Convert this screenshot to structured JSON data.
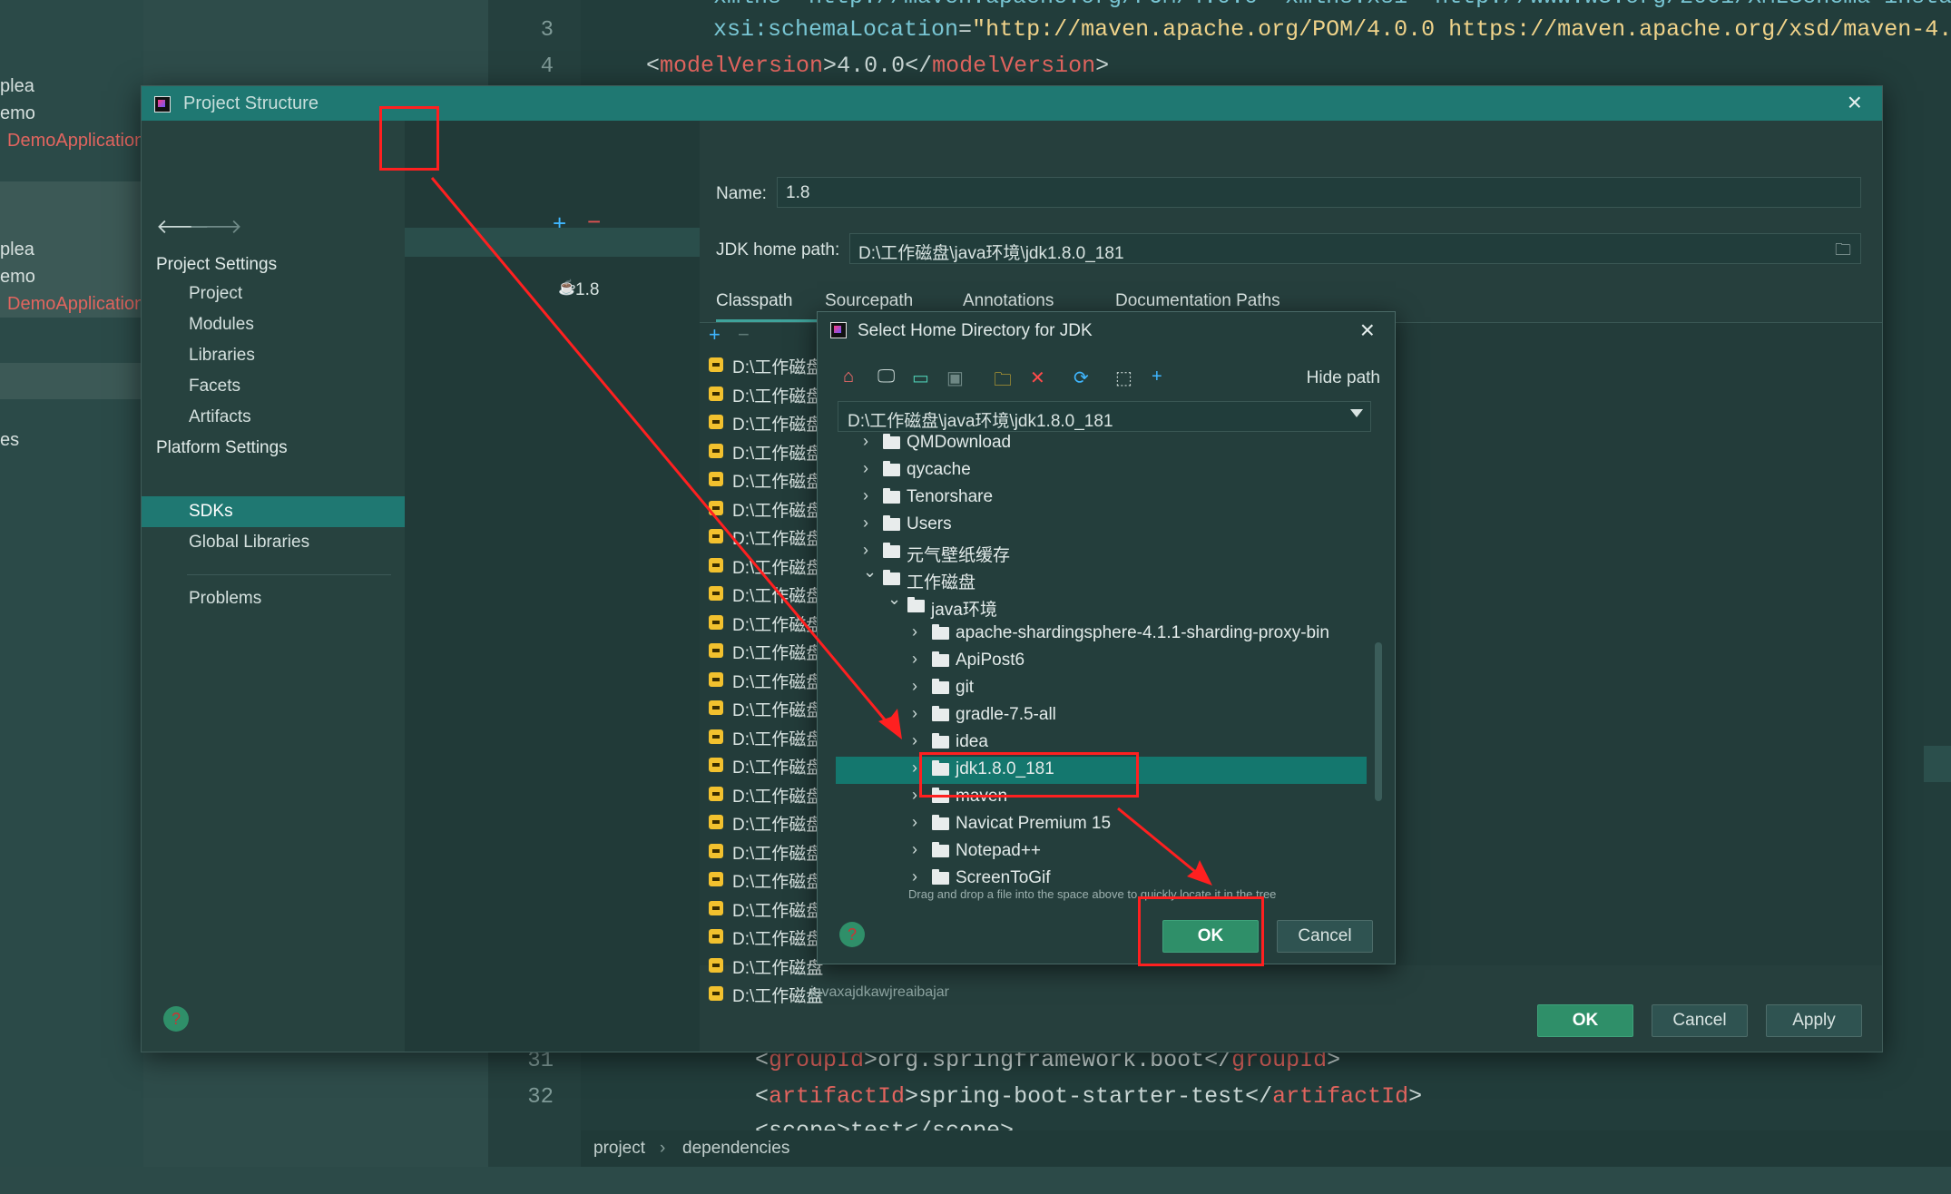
{
  "background": {
    "left_panel": [
      "plea",
      "emo",
      "DemoApplication",
      "plea",
      "emo",
      "DemoApplication",
      "es"
    ],
    "line_numbers": {
      "l3": "3",
      "l4": "4",
      "l31": "31",
      "l32": "32"
    },
    "code_line_2": "xmlns=\"http://maven.apache.org/POM/4.0.0\" xmlns:xsi=\"http://www.w3.org/2001/XMLSchema-insta",
    "code_line_3_attr": "xsi:schemaLocation",
    "code_line_3_value": "\"http://maven.apache.org/POM/4.0.0 https://maven.apache.org/xsd/maven-4.",
    "code_line_4_tag": "modelVersion",
    "code_line_4_value": "4.0.0",
    "code_line_31_tag": "groupId",
    "code_line_31_value": "org.springframework.boot",
    "code_line_32_tag": "artifactId",
    "code_line_32_value": "spring-boot-starter-test",
    "code_line_33_partial": "<scope>test</scope>",
    "breadcrumb": [
      "project",
      "dependencies"
    ]
  },
  "project_structure": {
    "title": "Project Structure",
    "project_settings_heading": "Project Settings",
    "project_settings_items": [
      "Project",
      "Modules",
      "Libraries",
      "Facets",
      "Artifacts"
    ],
    "platform_settings_heading": "Platform Settings",
    "platform_settings_items": [
      "SDKs",
      "Global Libraries"
    ],
    "problems": "Problems",
    "sdk_list": [
      "1.8"
    ],
    "name_label": "Name:",
    "name_value": "1.8",
    "jdk_home_label": "JDK home path:",
    "jdk_home_value": "D:\\工作磁盘\\java环境\\jdk1.8.0_181",
    "tabs": [
      "Classpath",
      "Sourcepath",
      "Annotations",
      "Documentation Paths"
    ],
    "classpath_prefix": "D:\\工作磁盘",
    "classpath_last_tail": "javaxajdkawjreaibajar",
    "buttons": {
      "ok": "OK",
      "cancel": "Cancel",
      "apply": "Apply"
    }
  },
  "select_dialog": {
    "title": "Select Home Directory for JDK",
    "hide_path": "Hide path",
    "path_value": "D:\\工作磁盘\\java环境\\jdk1.8.0_181",
    "tree": [
      "QMDownload",
      "qycache",
      "Tenorshare",
      "Users",
      "元气壁纸缓存",
      "工作磁盘",
      "java环境",
      "apache-shardingsphere-4.1.1-sharding-proxy-bin",
      "ApiPost6",
      "git",
      "gradle-7.5-all",
      "idea",
      "jdk1.8.0_181",
      "maven",
      "Navicat Premium 15",
      "Notepad++",
      "ScreenToGif"
    ],
    "hint": "Drag and drop a file into the space above to quickly locate it in the tree",
    "buttons": {
      "ok": "OK",
      "cancel": "Cancel"
    }
  },
  "colors": {
    "accent": "#1f7872",
    "primary_button": "#2f8f69",
    "annotation": "#ff2020"
  }
}
